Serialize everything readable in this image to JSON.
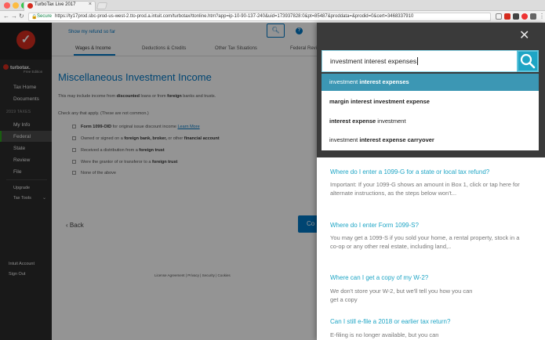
{
  "browser": {
    "tab_title": "TurboTax Live 2017",
    "secure_label": "Secure",
    "url": "https://ty17prod.sbc-prod-us-west-2.tto-prod.a.intuit.com/turbotax/ttonline.htm?app=ip-10-90-137-240&uid=173937828:0&pt=85487&proddata=&prodid=0&cert=3468337910"
  },
  "sidebar": {
    "brand": "turbotax.",
    "edition": "Free Edition",
    "items": [
      {
        "label": "Tax Home"
      },
      {
        "label": "Documents"
      }
    ],
    "section_heading": "2019 TAXES",
    "tax_items": [
      {
        "label": "My Info"
      },
      {
        "label": "Federal"
      },
      {
        "label": "State"
      },
      {
        "label": "Review"
      },
      {
        "label": "File"
      }
    ],
    "extra_items": [
      {
        "label": "Upgrade"
      },
      {
        "label": "Tax Tools"
      }
    ],
    "bottom_items": [
      {
        "label": "Intuit Account"
      },
      {
        "label": "Sign Out"
      }
    ]
  },
  "main": {
    "refund_link": "Show my refund so far",
    "tabs": [
      {
        "label": "Wages & Income"
      },
      {
        "label": "Deductions & Credits"
      },
      {
        "label": "Other Tax Situations"
      },
      {
        "label": "Federal Revi"
      }
    ],
    "title": "Miscellaneous Investment Income",
    "intro_prefix": "This may include income from",
    "intro_b1": "discounted",
    "intro_mid": "loans or from",
    "intro_b2": "foreign",
    "intro_suffix": "banks and trusts.",
    "check_prompt": "Check any that apply. (These are not common.)",
    "options": [
      {
        "b": "Form 1099-OID",
        "text": " for original issue discount income ",
        "link": "Learn More"
      },
      {
        "pre": "Owned or signed on a ",
        "b": "foreign bank, broker,",
        "mid": " or other ",
        "b2": "financial account"
      },
      {
        "pre": "Received a distribution from a ",
        "b": "foreign trust"
      },
      {
        "pre": "Were the grantor of or transferor to a ",
        "b": "foreign trust"
      },
      {
        "pre": "None of the above"
      }
    ],
    "back_label": "Back",
    "continue_label": "Co",
    "footer": "License Agreement | Privacy | Security | Cookies"
  },
  "search_panel": {
    "query": "investment interest expenses",
    "suggestions": [
      {
        "pre": "investment ",
        "b": "interest expenses",
        "post": ""
      },
      {
        "pre": "",
        "b": "margin interest investment expense",
        "post": ""
      },
      {
        "pre": "",
        "b": "interest expense",
        "post": " investment"
      },
      {
        "pre": "investment ",
        "b": "interest expense carryover",
        "post": ""
      }
    ],
    "results": [
      {
        "title": "Where do I enter a 1099-G for a state or local tax refund?",
        "body": "Important: If your 1099-G shows an amount in Box 1, click or tap here for alternate instructions, as the steps below won't..."
      },
      {
        "title": "Where do I enter Form 1099-S?",
        "body": "You may get a 1099-S if you sold your home, a rental property, stock in a co-op or any other real estate, including land,.."
      },
      {
        "title": "Where can I get a copy of my W-2?",
        "body": "We don't store your W-2, but we'll tell you how you can get a copy"
      },
      {
        "title": "Can I still e-file a 2018 or earlier tax return?",
        "body": "E-filing is no longer available, but you can"
      }
    ]
  },
  "colors": {
    "brand_red": "#d52b1e",
    "link_blue": "#0077c5",
    "search_teal": "#1ea5c5",
    "highlight": "#3c97b4",
    "active_green": "#2ca01c"
  }
}
